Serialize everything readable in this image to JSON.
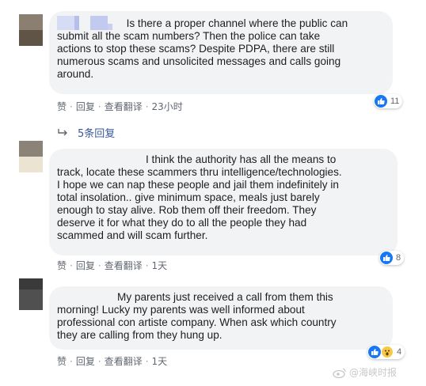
{
  "comments": [
    {
      "lines": [
        "submit all the scam numbers? Then the police can take",
        "actions to stop these scams? Despite PDPA, there are still",
        "numerous scams and unsolicited messages and calls going",
        "around."
      ],
      "first_line": "Is there a proper channel where the public can",
      "actions": {
        "like": "赞",
        "reply": "回复",
        "translate": "查看翻译",
        "time": "23小时"
      },
      "reaction_count": "11"
    },
    {
      "lines": [
        "I think the authority has all the means to",
        "track, locate these scammers thru intelligence/technologies.",
        "I hope we can nap these people and jail them indefinitely in",
        "total insolation.. give minimum space, meals just barely",
        "enough to stay alive. Rob them off their freedom. They",
        "deserve it for what they do to all the people they had",
        "scammed and will scam further."
      ],
      "actions": {
        "like": "赞",
        "reply": "回复",
        "translate": "查看翻译",
        "time": "1天"
      },
      "reaction_count": "8"
    },
    {
      "lines": [
        "My parents just received a call from them this",
        "morning! Lucky my parents was well informed about",
        "professional con artiste company. When ask which country",
        "they are calling from they hung up."
      ],
      "actions": {
        "like": "赞",
        "reply": "回复",
        "translate": "查看翻译",
        "time": "1天"
      },
      "reaction_count": "4"
    }
  ],
  "replies_link": "5条回复",
  "watermark": "@海峡时报",
  "colors": {
    "like_blue": "#1877f2",
    "bubble": "#f2f3f5",
    "link": "#385898"
  }
}
